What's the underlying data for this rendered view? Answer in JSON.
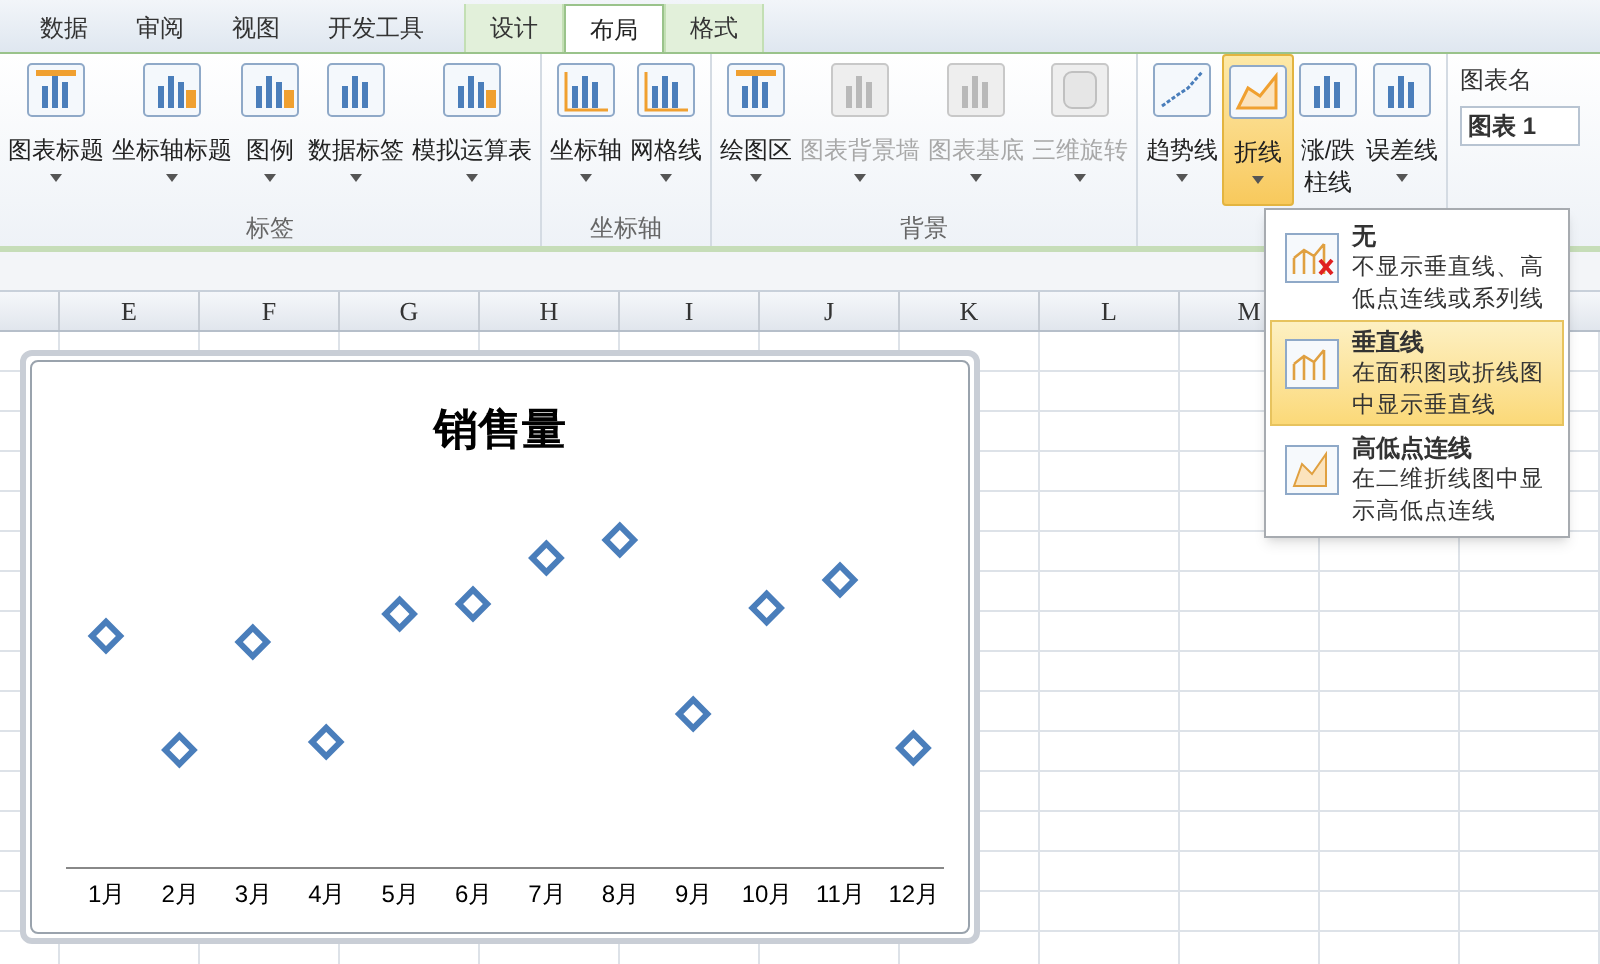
{
  "tabs": [
    {
      "label": "数据",
      "selected": false,
      "kind": "normal"
    },
    {
      "label": "审阅",
      "selected": false,
      "kind": "normal"
    },
    {
      "label": "视图",
      "selected": false,
      "kind": "normal"
    },
    {
      "label": "开发工具",
      "selected": false,
      "kind": "normal"
    },
    {
      "label": "设计",
      "selected": false,
      "kind": "contextual"
    },
    {
      "label": "布局",
      "selected": true,
      "kind": "contextual"
    },
    {
      "label": "格式",
      "selected": false,
      "kind": "contextual"
    }
  ],
  "groups": [
    {
      "label": "标签",
      "buttons": [
        {
          "lines": [
            "图表标题"
          ],
          "disabled": false,
          "pressed": false
        },
        {
          "lines": [
            "坐标轴标题"
          ],
          "disabled": false,
          "pressed": false
        },
        {
          "lines": [
            "图例"
          ],
          "disabled": false,
          "pressed": false
        },
        {
          "lines": [
            "数据标签"
          ],
          "disabled": false,
          "pressed": false
        },
        {
          "lines": [
            "模拟运算表"
          ],
          "disabled": false,
          "pressed": false
        }
      ]
    },
    {
      "label": "坐标轴",
      "buttons": [
        {
          "lines": [
            "坐标轴"
          ],
          "disabled": false,
          "pressed": false
        },
        {
          "lines": [
            "网格线"
          ],
          "disabled": false,
          "pressed": false
        }
      ]
    },
    {
      "label": "背景",
      "buttons": [
        {
          "lines": [
            "绘图区"
          ],
          "disabled": false,
          "pressed": false
        },
        {
          "lines": [
            "图表背景墙"
          ],
          "disabled": true,
          "pressed": false
        },
        {
          "lines": [
            "图表基底"
          ],
          "disabled": true,
          "pressed": false
        },
        {
          "lines": [
            "三维旋转"
          ],
          "disabled": true,
          "pressed": false
        }
      ]
    },
    {
      "buttons": [
        {
          "lines": [
            "趋势线"
          ],
          "disabled": false,
          "pressed": false
        },
        {
          "lines": [
            "折线"
          ],
          "disabled": false,
          "pressed": true
        },
        {
          "lines": [
            "涨/跌",
            "柱线"
          ],
          "disabled": false,
          "pressed": false
        },
        {
          "lines": [
            "误差线"
          ],
          "disabled": false,
          "pressed": false
        }
      ]
    }
  ],
  "chart_name": {
    "label": "图表名",
    "value": "图表 1"
  },
  "columns": [
    "E",
    "F",
    "G",
    "H",
    "I",
    "J",
    "K",
    "L",
    "M"
  ],
  "chart": {
    "title": "销售量",
    "categories": [
      "1月",
      "2月",
      "3月",
      "4月",
      "5月",
      "6月",
      "7月",
      "8月",
      "9月",
      "10月",
      "11月",
      "12月"
    ]
  },
  "menu": [
    {
      "title": "无",
      "description": "不显示垂直线、高低点连线或系列线",
      "selected": false,
      "kind": "none"
    },
    {
      "title": "垂直线",
      "description": "在面积图或折线图中显示垂直线",
      "selected": true,
      "kind": "drop"
    },
    {
      "title": "高低点连线",
      "description": "在二维折线图中显示高低点连线",
      "selected": false,
      "kind": "highlow"
    }
  ]
}
